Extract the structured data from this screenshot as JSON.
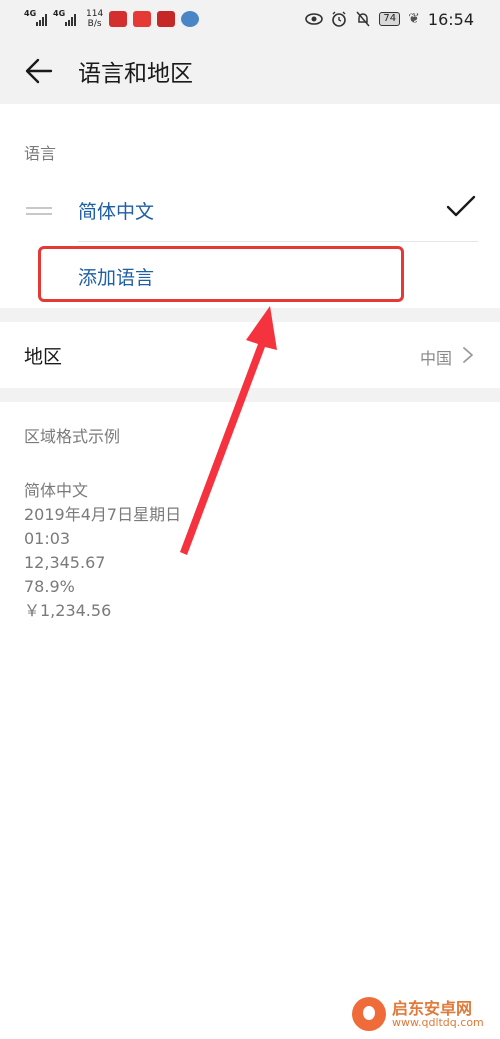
{
  "status_bar": {
    "network_1": "4G",
    "network_2": "4G",
    "speed_value": "114",
    "speed_unit": "B/s",
    "battery": "74",
    "time": "16:54"
  },
  "header": {
    "title": "语言和地区"
  },
  "language_section": {
    "label": "语言",
    "selected_language": "简体中文",
    "add_language": "添加语言"
  },
  "region_section": {
    "title": "地区",
    "value": "中国"
  },
  "format_section": {
    "label": "区域格式示例",
    "examples": [
      "简体中文",
      "2019年4月7日星期日",
      "01:03",
      "12,345.67",
      "78.9%",
      "￥1,234.56"
    ]
  },
  "watermark": {
    "name": "启东安卓网",
    "url": "www.qdltdq.com"
  },
  "colors": {
    "accent_blue": "#1f5fa6",
    "highlight_red": "#e53935"
  },
  "icons": {
    "back": "back-arrow-icon",
    "check": "check-icon",
    "drag": "drag-handle-icon",
    "chevron": "chevron-right-icon"
  }
}
